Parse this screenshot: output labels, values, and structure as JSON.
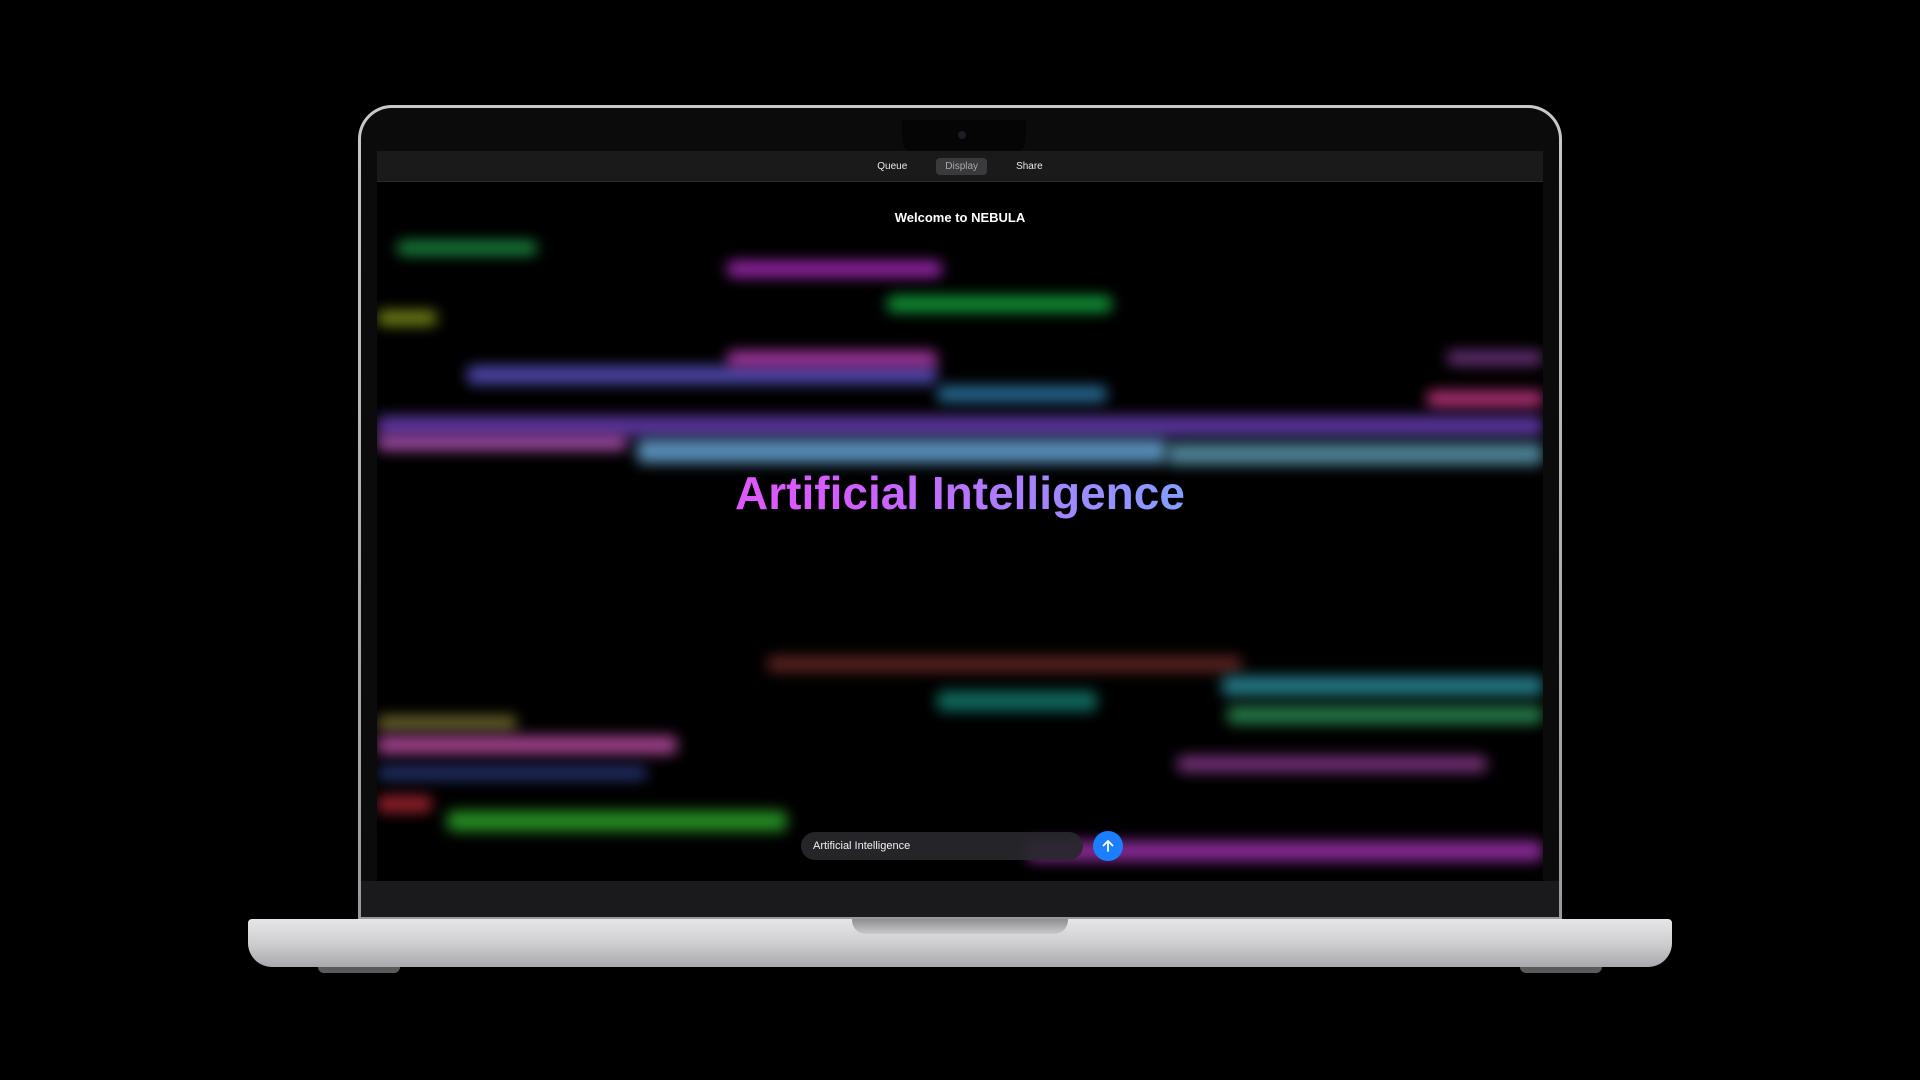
{
  "toolbar": {
    "tabs": [
      {
        "label": "Queue"
      },
      {
        "label": "Display"
      },
      {
        "label": "Share"
      }
    ],
    "active_tab": "Display"
  },
  "main": {
    "welcome": "Welcome to NEBULA",
    "headline": "Artificial Intelligence"
  },
  "composer": {
    "value": "Artificial Intelligence",
    "send_icon": "arrow-up-icon"
  },
  "colors": {
    "accent": "#1a7fff",
    "headline_start": "#ff4fe0",
    "headline_end": "#2fe6ff"
  }
}
